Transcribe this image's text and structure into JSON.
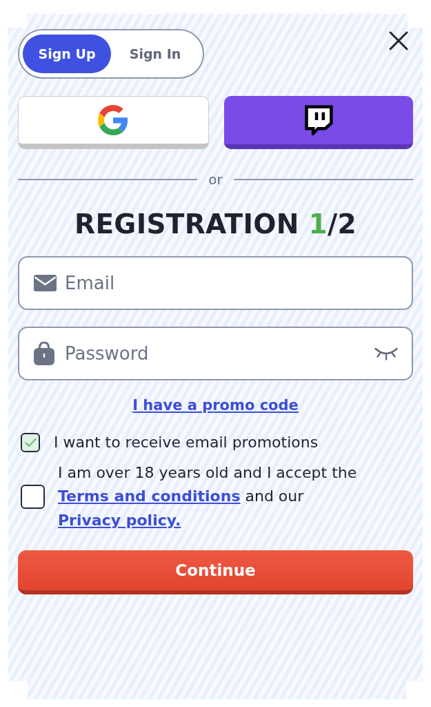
{
  "tabs": [
    {
      "label": "Sign Up",
      "selected": true
    },
    {
      "label": "Sign In",
      "selected": false
    }
  ],
  "social_buttons": [
    {
      "kind": "google"
    },
    {
      "kind": "twitch"
    }
  ],
  "divider": {
    "label": "or"
  },
  "heading": {
    "title": "REGISTRATION",
    "step": "1",
    "step_total": "/2"
  },
  "fields": [
    {
      "kind": "email",
      "placeholder": "Email"
    },
    {
      "kind": "password",
      "placeholder": "Password"
    }
  ],
  "promo_link": {
    "label": "I have a promo code"
  },
  "checkboxes": [
    {
      "checked": true,
      "parts": [
        {
          "kind": "text",
          "text": "I want to receive email promotions"
        }
      ]
    },
    {
      "checked": false,
      "parts": [
        {
          "kind": "text",
          "text": "I am over 18 years old and I accept the"
        },
        {
          "kind": "link",
          "text": "Terms and conditions"
        },
        {
          "kind": "text",
          "text": "and our"
        },
        {
          "kind": "link",
          "text": "Privacy policy."
        }
      ]
    }
  ],
  "submit_button": {
    "label": "Continue"
  }
}
